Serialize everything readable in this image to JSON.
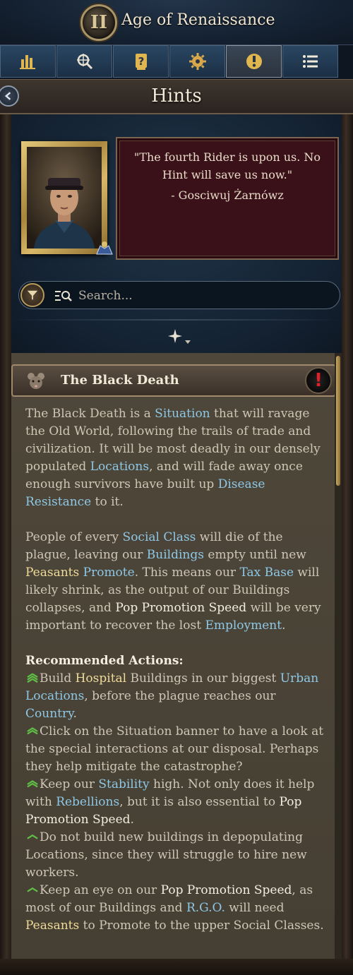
{
  "window": {
    "emblem": "II",
    "title": "Age of Renaissance"
  },
  "tabs": [
    {
      "name": "tab-statistics",
      "icon": "bar-chart-icon",
      "active": false
    },
    {
      "name": "tab-search-map",
      "icon": "magnifier-compass-icon",
      "active": false
    },
    {
      "name": "tab-question",
      "icon": "question-scroll-icon",
      "active": false
    },
    {
      "name": "tab-settings",
      "icon": "gear-icon",
      "active": false
    },
    {
      "name": "tab-info",
      "icon": "info-icon",
      "active": true
    },
    {
      "name": "tab-list",
      "icon": "list-icon",
      "active": false
    }
  ],
  "header": {
    "title": "Hints"
  },
  "advisor": {
    "quote": "\"The fourth Rider is upon us. No Hint will save us now.\"",
    "author": "- Gosciwuj Żarnówz"
  },
  "search": {
    "placeholder": "Search..."
  },
  "hint": {
    "title": "The Black Death",
    "icon": "rat-icon",
    "alert": "!",
    "p1": [
      {
        "t": "The Black Death is a ",
        "c": ""
      },
      {
        "t": "Situation",
        "c": "lnk"
      },
      {
        "t": " that will ravage the Old World, following the trails of trade and civilization. It will be most deadly in our densely populated ",
        "c": ""
      },
      {
        "t": "Locations",
        "c": "lnk"
      },
      {
        "t": ", and will fade away once enough survivors have built up ",
        "c": ""
      },
      {
        "t": "Disease Resistance",
        "c": "lnk"
      },
      {
        "t": " to it.",
        "c": ""
      }
    ],
    "p2": [
      {
        "t": "People of every ",
        "c": ""
      },
      {
        "t": "Social Class",
        "c": "lnk"
      },
      {
        "t": " will die of the plague, leaving our ",
        "c": ""
      },
      {
        "t": "Buildings",
        "c": "lnk"
      },
      {
        "t": " empty until new ",
        "c": ""
      },
      {
        "t": "Peasants",
        "c": "hl"
      },
      {
        "t": " ",
        "c": ""
      },
      {
        "t": "Promote",
        "c": "lnk"
      },
      {
        "t": ". This means our ",
        "c": ""
      },
      {
        "t": "Tax Base",
        "c": "lnk"
      },
      {
        "t": " will likely shrink, as the output of our Buildings collapses, and ",
        "c": ""
      },
      {
        "t": "Pop Promotion Speed",
        "c": "wt"
      },
      {
        "t": " will be very important to recover the lost ",
        "c": ""
      },
      {
        "t": "Employment",
        "c": "lnk"
      },
      {
        "t": ".",
        "c": ""
      }
    ],
    "actions_heading": "Recommended Actions:",
    "actions": [
      {
        "level": "high",
        "parts": [
          {
            "t": "Build ",
            "c": ""
          },
          {
            "t": "Hospital",
            "c": "hl"
          },
          {
            "t": " Buildings in our biggest ",
            "c": ""
          },
          {
            "t": "Urban Locations",
            "c": "lnk"
          },
          {
            "t": ", before the plague reaches our ",
            "c": ""
          },
          {
            "t": "Country",
            "c": "lnk"
          },
          {
            "t": ".",
            "c": ""
          }
        ]
      },
      {
        "level": "medium",
        "parts": [
          {
            "t": "Click on the Situation banner to have a look at the special interactions at our disposal. Perhaps they help mitigate the catastrophe?",
            "c": ""
          }
        ]
      },
      {
        "level": "medium",
        "parts": [
          {
            "t": "Keep our ",
            "c": ""
          },
          {
            "t": "Stability",
            "c": "lnk"
          },
          {
            "t": " high. Not only does it help with ",
            "c": ""
          },
          {
            "t": "Rebellions",
            "c": "lnk"
          },
          {
            "t": ", but it is also essential to ",
            "c": ""
          },
          {
            "t": "Pop Promotion Speed",
            "c": "wt"
          },
          {
            "t": ".",
            "c": ""
          }
        ]
      },
      {
        "level": "low",
        "parts": [
          {
            "t": "Do not build new buildings in depopulating Locations, since they will struggle to hire new workers.",
            "c": ""
          }
        ]
      },
      {
        "level": "low",
        "parts": [
          {
            "t": "Keep an eye on our ",
            "c": ""
          },
          {
            "t": "Pop Promotion Speed",
            "c": "wt"
          },
          {
            "t": ", as most of our Buildings and ",
            "c": ""
          },
          {
            "t": "R.G.O.",
            "c": "lnk"
          },
          {
            "t": " will need ",
            "c": ""
          },
          {
            "t": "Peasants",
            "c": "hl"
          },
          {
            "t": " to Promote to the upper Social Classes.",
            "c": ""
          }
        ]
      }
    ]
  },
  "colors": {
    "link": "#8ec8e6",
    "highlight": "#f0dc9a",
    "quote_bg": "#3a1019",
    "priority_green": "#4fae3a"
  }
}
